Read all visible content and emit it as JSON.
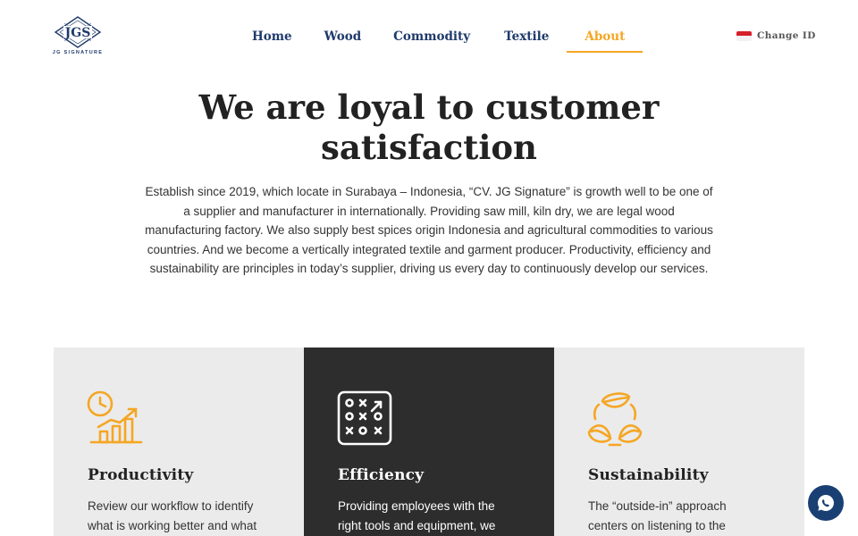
{
  "brand": {
    "logo_text": "JGS",
    "caption": "JG SIGNATURE"
  },
  "nav": {
    "items": [
      {
        "label": "Home"
      },
      {
        "label": "Wood"
      },
      {
        "label": "Commodity"
      },
      {
        "label": "Textile"
      },
      {
        "label": "About",
        "active": true
      }
    ]
  },
  "language": {
    "label": "Change ID",
    "flag": "indonesia-flag"
  },
  "hero": {
    "title_line1": "We are loyal to customer",
    "title_line2": "satisfaction",
    "lines": [
      "Establish since 2019, which locate in Surabaya – Indonesia, “CV. JG Signature” is growth well to be one of",
      "a supplier and manufacturer in internationally. Providing saw mill, kiln dry, we are legal wood",
      "manufacturing factory. We also supply best spices origin Indonesia and agricultural commodities to various",
      "countries. And we become a vertically integrated textile and garment producer. Productivity, efficiency and",
      "sustainability are principles in today’s supplier, driving us every day to continuously develop our services."
    ]
  },
  "cards": [
    {
      "title": "Productivity",
      "icon": "productivity-chart-icon",
      "lines": [
        "Review our workflow to identify",
        "what is working better and what"
      ]
    },
    {
      "title": "Efficiency",
      "icon": "strategy-board-icon",
      "lines": [
        "Providing employees with the",
        "right tools and equipment, we"
      ]
    },
    {
      "title": "Sustainability",
      "icon": "recycle-leaves-icon",
      "lines": [
        "The “outside-in” approach",
        "centers on listening to the"
      ]
    }
  ],
  "colors": {
    "navy": "#1f3a6b",
    "accent": "#f5a623",
    "dark_card": "#2d2d2d",
    "light_card": "#ebebeb",
    "chat": "#1a3f73"
  },
  "chat": {
    "icon": "whatsapp-icon"
  }
}
